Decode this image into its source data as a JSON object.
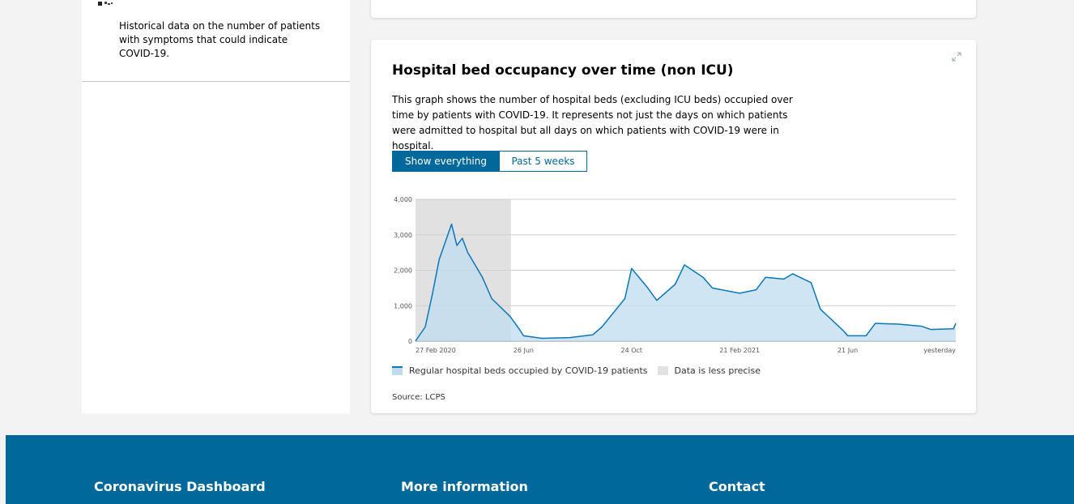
{
  "sidebar": {
    "item_description": "Historical data on the number of patients with symptoms that could indicate COVID-19."
  },
  "card": {
    "title": "Hospital bed occupancy over time (non ICU)",
    "description": "This graph shows the number of hospital beds (excluding ICU beds) occupied over time by patients with COVID-19. It represents not just the days on which patients were admitted to hospital but all days on which patients with COVID-19 were in hospital.",
    "toggle": {
      "active_label": "Show everything",
      "inactive_label": "Past 5 weeks"
    },
    "legend": {
      "series_label": "Regular hospital beds occupied by COVID-19 patients",
      "shaded_label": "Data is less precise"
    },
    "source": "Source: LCPS",
    "expand_icon": "expand-icon"
  },
  "chart_data": {
    "type": "area",
    "y_ticks": [
      "4,000",
      "3,000",
      "2,000",
      "1,000",
      "0"
    ],
    "x_ticks": [
      "27 Feb 2020",
      "26 Jun",
      "24 Oct",
      "21 Feb 2021",
      "21 Jun",
      "yesterday"
    ],
    "ylim": [
      0,
      4000
    ],
    "grid": true,
    "shaded_region_label": "Data is less precise",
    "shaded_region_x": [
      "27 Feb 2020",
      "Jun 2020"
    ],
    "series": [
      {
        "name": "Regular hospital beds occupied by COVID-19 patients",
        "color": "#0a77b7",
        "fill": "#bfdcef",
        "points": [
          [
            "27 Feb 2020",
            0
          ],
          [
            "Mar 2020",
            400
          ],
          [
            "Mar 2020",
            1300
          ],
          [
            "Mar 2020",
            2300
          ],
          [
            "Apr 2020",
            3300
          ],
          [
            "Apr 2020",
            2700
          ],
          [
            "Apr 2020",
            2900
          ],
          [
            "Apr 2020",
            2500
          ],
          [
            "May 2020",
            1800
          ],
          [
            "May 2020",
            1200
          ],
          [
            "Jun 2020",
            700
          ],
          [
            "Jun 2020",
            350
          ],
          [
            "26 Jun",
            150
          ],
          [
            "Jul 2020",
            80
          ],
          [
            "Aug 2020",
            100
          ],
          [
            "Sep 2020",
            180
          ],
          [
            "Sep 2020",
            400
          ],
          [
            "Oct 2020",
            1200
          ],
          [
            "24 Oct",
            2050
          ],
          [
            "Nov 2020",
            1500
          ],
          [
            "Nov 2020",
            1150
          ],
          [
            "Dec 2020",
            1600
          ],
          [
            "Dec 2020",
            2150
          ],
          [
            "Jan 2021",
            1800
          ],
          [
            "Jan 2021",
            1500
          ],
          [
            "21 Feb 2021",
            1350
          ],
          [
            "Mar 2021",
            1450
          ],
          [
            "Mar 2021",
            1800
          ],
          [
            "Apr 2021",
            1750
          ],
          [
            "Apr 2021",
            1900
          ],
          [
            "May 2021",
            1650
          ],
          [
            "May 2021",
            900
          ],
          [
            "Jun 2021",
            300
          ],
          [
            "21 Jun",
            150
          ],
          [
            "Jul 2021",
            150
          ],
          [
            "Jul 2021",
            500
          ],
          [
            "Aug 2021",
            480
          ],
          [
            "Sep 2021",
            420
          ],
          [
            "Sep 2021",
            330
          ],
          [
            "Oct 2021",
            350
          ],
          [
            "yesterday",
            500
          ]
        ]
      }
    ]
  },
  "footer": {
    "col1": "Coronavirus Dashboard",
    "col2": "More information",
    "col3": "Contact"
  }
}
